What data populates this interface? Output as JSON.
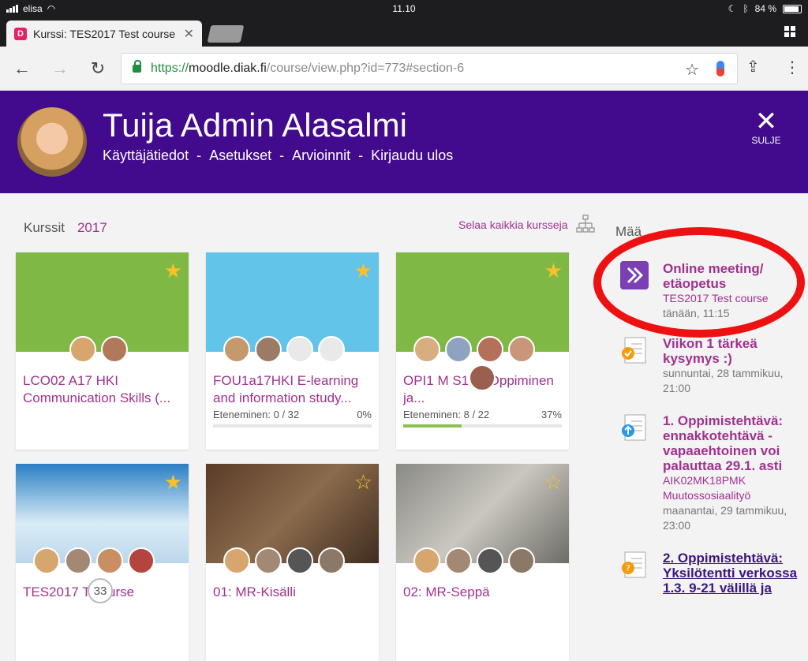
{
  "status": {
    "carrier": "elisa",
    "time": "11.10",
    "battery": "84 %"
  },
  "tab": {
    "title": "Kurssi: TES2017 Test course",
    "favicon": "D"
  },
  "url": {
    "scheme": "https://",
    "domain": "moodle.diak.fi",
    "path": "/course/view.php?id=773#section-6"
  },
  "header": {
    "name": "Tuija Admin Alasalmi",
    "links": [
      "Käyttäjätiedot",
      "-",
      "Asetukset",
      "-",
      "Arvioinnit",
      "-",
      "Kirjaudu ulos"
    ],
    "close_label": "SULJE"
  },
  "crumbs": {
    "label": "Kurssit",
    "year": "2017"
  },
  "browse_label": "Selaa kaikkia kursseja",
  "courses": [
    {
      "title": "LCO02 A17 HKI Communication Skills (...",
      "progress_label": "",
      "pct": ""
    },
    {
      "title": "FOU1a17HKI E-learning and information study...",
      "progress_label": "Eteneminen: 0 / 32",
      "pct": "0%",
      "progress": 0
    },
    {
      "title": "OPI1 M S1 KI Oppiminen ja...",
      "progress_label": "Eteneminen: 8 / 22",
      "pct": "37%",
      "progress": 0.37
    },
    {
      "title": "TES2017 T course",
      "progress_label": "",
      "pct": ""
    },
    {
      "title": "01: MR-Kisälli",
      "progress_label": "",
      "pct": ""
    },
    {
      "title": "02: MR-Seppä",
      "progress_label": "",
      "pct": ""
    }
  ],
  "sidebar": {
    "heading": "Mää",
    "events": [
      {
        "title": "Online meeting/ etäopetus",
        "sub": "TES2017 Test course",
        "date": "tänään, 11:15"
      },
      {
        "title": "Viikon 1 tärkeä kysymys :)",
        "sub": "",
        "date": "sunnuntai, 28 tammikuu, 21:00"
      },
      {
        "title": "1. Oppimistehtävä: ennakkotehtävä - vapaaehtoinen voi palauttaa 29.1. asti",
        "sub": "AIK02MK18PMK Muutossosiaalityö",
        "date": "maanantai, 29 tammikuu, 23:00"
      },
      {
        "title": "2. Oppimistehtävä: Yksilötentti verkossa 1.3. 9-21 välillä ja",
        "sub": "",
        "date": ""
      }
    ]
  },
  "fab_label": "33"
}
